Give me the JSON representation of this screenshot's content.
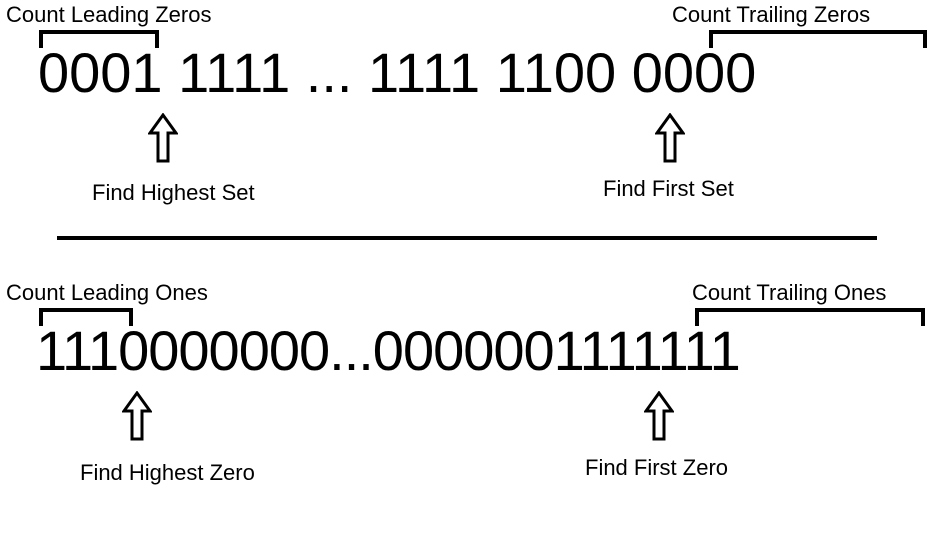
{
  "top": {
    "leading_label": "Count Leading Zeros",
    "trailing_label": "Count Trailing Zeros",
    "digits": "0001 1111 ... 1111 1100 0000",
    "highest_label": "Find Highest Set",
    "first_label": "Find First Set"
  },
  "bottom": {
    "leading_label": "Count Leading Ones",
    "trailing_label": "Count Trailing Ones",
    "digits": "1110000000...0000001111111",
    "highest_label": "Find Highest Zero",
    "first_label": "Find First Zero"
  }
}
